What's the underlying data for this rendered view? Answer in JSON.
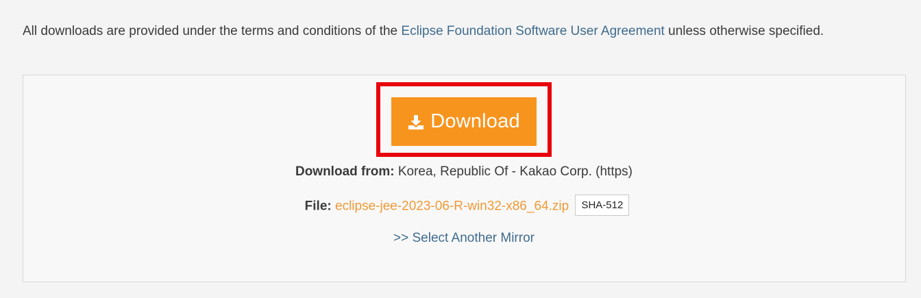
{
  "intro": {
    "text_before": "All downloads are provided under the terms and conditions of the ",
    "link_label": "Eclipse Foundation Software User Agreement",
    "text_after": " unless otherwise specified."
  },
  "download_button": {
    "label": "Download",
    "icon": "download-icon",
    "color": "#f7941e"
  },
  "highlight_color": "#e8000c",
  "download_from": {
    "label": "Download from:",
    "value": "Korea, Republic Of - Kakao Corp. (https)"
  },
  "file": {
    "label": "File:",
    "name": "eclipse-jee-2023-06-R-win32-x86_64.zip",
    "checksum_label": "SHA-512"
  },
  "mirror_link": ">> Select Another Mirror"
}
